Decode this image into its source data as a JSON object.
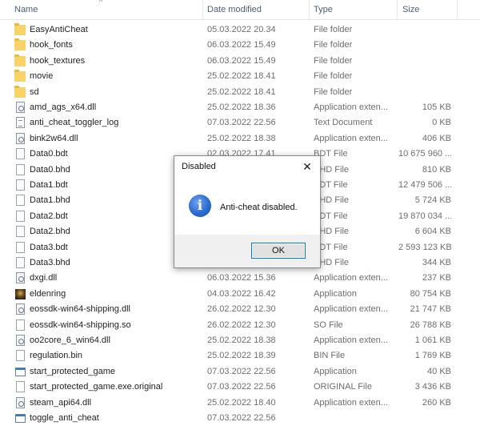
{
  "columns": {
    "name": "Name",
    "date": "Date modified",
    "type": "Type",
    "size": "Size"
  },
  "files": [
    {
      "name": "EasyAntiCheat",
      "date": "05.03.2022 20.34",
      "type": "File folder",
      "size": "",
      "icon": "folder-icon"
    },
    {
      "name": "hook_fonts",
      "date": "06.03.2022 15.49",
      "type": "File folder",
      "size": "",
      "icon": "folder-icon"
    },
    {
      "name": "hook_textures",
      "date": "06.03.2022 15.49",
      "type": "File folder",
      "size": "",
      "icon": "folder-icon"
    },
    {
      "name": "movie",
      "date": "25.02.2022 18.41",
      "type": "File folder",
      "size": "",
      "icon": "folder-icon"
    },
    {
      "name": "sd",
      "date": "25.02.2022 18.41",
      "type": "File folder",
      "size": "",
      "icon": "folder-icon"
    },
    {
      "name": "amd_ags_x64.dll",
      "date": "25.02.2022 18.36",
      "type": "Application exten...",
      "size": "105 KB",
      "icon": "dll-icon"
    },
    {
      "name": "anti_cheat_toggler_log",
      "date": "07.03.2022 22.56",
      "type": "Text Document",
      "size": "0 KB",
      "icon": "text-icon"
    },
    {
      "name": "bink2w64.dll",
      "date": "25.02.2022 18.38",
      "type": "Application exten...",
      "size": "406 KB",
      "icon": "dll-icon"
    },
    {
      "name": "Data0.bdt",
      "date": "02.03.2022 17.41",
      "type": "BDT File",
      "size": "10 675 960 ...",
      "icon": "file-icon"
    },
    {
      "name": "Data0.bhd",
      "date": "",
      "type": "BHD File",
      "size": "810 KB",
      "icon": "file-icon"
    },
    {
      "name": "Data1.bdt",
      "date": "",
      "type": "BDT File",
      "size": "12 479 506 ...",
      "icon": "file-icon"
    },
    {
      "name": "Data1.bhd",
      "date": "",
      "type": "BHD File",
      "size": "5 724 KB",
      "icon": "file-icon"
    },
    {
      "name": "Data2.bdt",
      "date": "",
      "type": "BDT File",
      "size": "19 870 034 ...",
      "icon": "file-icon"
    },
    {
      "name": "Data2.bhd",
      "date": "",
      "type": "BHD File",
      "size": "6 604 KB",
      "icon": "file-icon"
    },
    {
      "name": "Data3.bdt",
      "date": "",
      "type": "BDT File",
      "size": "2 593 123 KB",
      "icon": "file-icon"
    },
    {
      "name": "Data3.bhd",
      "date": "",
      "type": "BHD File",
      "size": "344 KB",
      "icon": "file-icon"
    },
    {
      "name": "dxgi.dll",
      "date": "06.03.2022 15.36",
      "type": "Application exten...",
      "size": "237 KB",
      "icon": "dll-icon"
    },
    {
      "name": "eldenring",
      "date": "04.03.2022 16.42",
      "type": "Application",
      "size": "80 754 KB",
      "icon": "game-icon"
    },
    {
      "name": "eossdk-win64-shipping.dll",
      "date": "26.02.2022 12.30",
      "type": "Application exten...",
      "size": "21 747 KB",
      "icon": "dll-icon"
    },
    {
      "name": "eossdk-win64-shipping.so",
      "date": "26.02.2022 12.30",
      "type": "SO File",
      "size": "26 788 KB",
      "icon": "file-icon"
    },
    {
      "name": "oo2core_6_win64.dll",
      "date": "25.02.2022 18.38",
      "type": "Application exten...",
      "size": "1 061 KB",
      "icon": "dll-icon"
    },
    {
      "name": "regulation.bin",
      "date": "25.02.2022 18.39",
      "type": "BIN File",
      "size": "1 769 KB",
      "icon": "file-icon"
    },
    {
      "name": "start_protected_game",
      "date": "07.03.2022 22.56",
      "type": "Application",
      "size": "40 KB",
      "icon": "exe-icon"
    },
    {
      "name": "start_protected_game.exe.original",
      "date": "07.03.2022 22.56",
      "type": "ORIGINAL File",
      "size": "3 436 KB",
      "icon": "file-icon"
    },
    {
      "name": "steam_api64.dll",
      "date": "25.02.2022 18.40",
      "type": "Application exten...",
      "size": "260 KB",
      "icon": "dll-icon"
    },
    {
      "name": "toggle_anti_cheat",
      "date": "07.03.2022 22.56",
      "type": "",
      "size": "",
      "icon": "exe-icon"
    }
  ],
  "dialog": {
    "title": "Disabled",
    "close_glyph": "✕",
    "info_glyph": "i",
    "message": "Anti-cheat disabled.",
    "ok_label": "OK"
  }
}
